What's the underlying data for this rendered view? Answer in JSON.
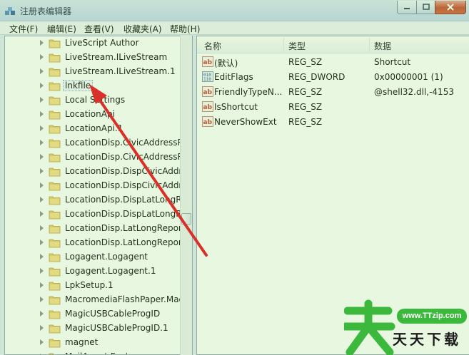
{
  "window": {
    "title": "注册表编辑器",
    "icon": "regedit-icon"
  },
  "menu": [
    "文件(F)",
    "编辑(E)",
    "查看(V)",
    "收藏夹(A)",
    "帮助(H)"
  ],
  "tree": {
    "items": [
      "LiveScript Author",
      "LiveStream.ILiveStream",
      "LiveStream.ILiveStream.1",
      "lnkfile",
      "Local Settings",
      "LocationApi",
      "LocationApi.1",
      "LocationDisp.CivicAddressRe",
      "LocationDisp.CivicAddressRe",
      "LocationDisp.DispCivicAddre",
      "LocationDisp.DispCivicAddre",
      "LocationDisp.DispLatLongRe",
      "LocationDisp.DispLatLongRe",
      "LocationDisp.LatLongReport",
      "LocationDisp.LatLongReport",
      "Logagent.Logagent",
      "Logagent.Logagent.1",
      "LpkSetup.1",
      "MacromediaFlashPaper.Mac",
      "MagicUSBCableProgID",
      "MagicUSBCableProgID.1",
      "magnet",
      "MailAgent.Feature"
    ],
    "selected_index": 3,
    "scroll_position": 0.58
  },
  "values": {
    "columns": [
      "名称",
      "类型",
      "数据"
    ],
    "rows": [
      {
        "icon": "string-value-icon",
        "name": "(默认)",
        "type": "REG_SZ",
        "data": "Shortcut"
      },
      {
        "icon": "binary-value-icon",
        "name": "EditFlags",
        "type": "REG_DWORD",
        "data": "0x00000001 (1)"
      },
      {
        "icon": "string-value-icon",
        "name": "FriendlyTypeN...",
        "type": "REG_SZ",
        "data": "@shell32.dll,-4153"
      },
      {
        "icon": "string-value-icon",
        "name": "IsShortcut",
        "type": "REG_SZ",
        "data": ""
      },
      {
        "icon": "string-value-icon",
        "name": "NeverShowExt",
        "type": "REG_SZ",
        "data": ""
      }
    ]
  },
  "watermark": {
    "url": "www.TTzip.com",
    "text": "天天下载",
    "brand_color": "#3cb93c"
  },
  "colors": {
    "annotation_arrow": "#d9302a",
    "overlay_green": "#96dc6e"
  }
}
